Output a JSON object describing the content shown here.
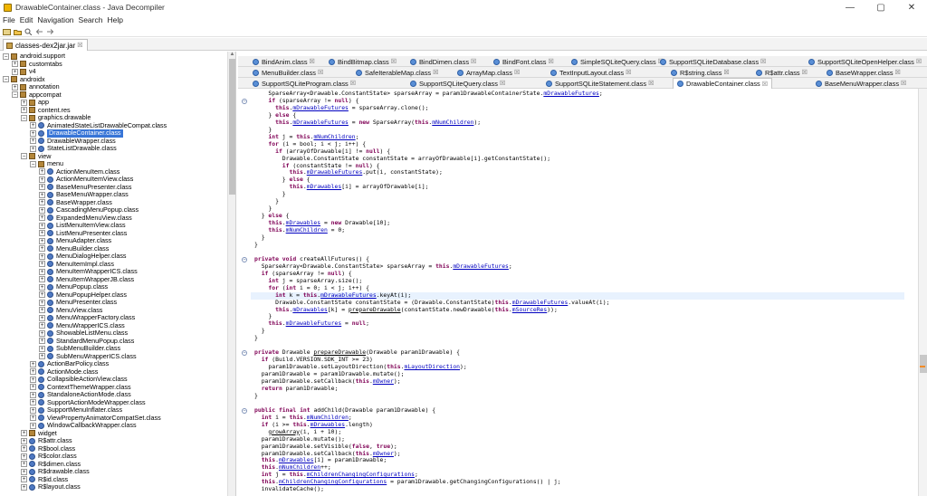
{
  "window": {
    "title": "DrawableContainer.class - Java Decompiler",
    "minimize": "—",
    "maximize": "▢",
    "close": "✕"
  },
  "menu": [
    "File",
    "Edit",
    "Navigation",
    "Search",
    "Help"
  ],
  "toolbar_icons": [
    "open-file-icon",
    "open-folder-icon",
    "search-icon",
    "back-icon",
    "forward-icon"
  ],
  "file_tab": {
    "label": "classes-dex2jar.jar",
    "close": "☒"
  },
  "tree": [
    {
      "d": 0,
      "exp": "−",
      "ico": "pkg",
      "label": "android.support"
    },
    {
      "d": 1,
      "exp": "+",
      "ico": "pkg",
      "label": "customtabs"
    },
    {
      "d": 1,
      "exp": "+",
      "ico": "pkg",
      "label": "v4"
    },
    {
      "d": 0,
      "exp": "−",
      "ico": "pkg",
      "label": "androidx"
    },
    {
      "d": 1,
      "exp": "+",
      "ico": "pkg",
      "label": "annotation"
    },
    {
      "d": 1,
      "exp": "−",
      "ico": "pkg",
      "label": "appcompat"
    },
    {
      "d": 2,
      "exp": "+",
      "ico": "pkg",
      "label": "app"
    },
    {
      "d": 2,
      "exp": "+",
      "ico": "pkg",
      "label": "content.res"
    },
    {
      "d": 2,
      "exp": "−",
      "ico": "pkg",
      "label": "graphics.drawable"
    },
    {
      "d": 3,
      "exp": "+",
      "ico": "cls",
      "label": "AnimatedStateListDrawableCompat.class"
    },
    {
      "d": 3,
      "exp": "+",
      "ico": "cls",
      "label": "DrawableContainer.class",
      "sel": true
    },
    {
      "d": 3,
      "exp": "+",
      "ico": "cls",
      "label": "DrawableWrapper.class"
    },
    {
      "d": 3,
      "exp": "+",
      "ico": "cls",
      "label": "StateListDrawable.class"
    },
    {
      "d": 2,
      "exp": "−",
      "ico": "pkg",
      "label": "view"
    },
    {
      "d": 3,
      "exp": "−",
      "ico": "pkg",
      "label": "menu"
    },
    {
      "d": 4,
      "exp": "+",
      "ico": "cls",
      "label": "ActionMenuItem.class"
    },
    {
      "d": 4,
      "exp": "+",
      "ico": "cls",
      "label": "ActionMenuItemView.class"
    },
    {
      "d": 4,
      "exp": "+",
      "ico": "cls",
      "label": "BaseMenuPresenter.class"
    },
    {
      "d": 4,
      "exp": "+",
      "ico": "cls",
      "label": "BaseMenuWrapper.class"
    },
    {
      "d": 4,
      "exp": "+",
      "ico": "cls",
      "label": "BaseWrapper.class"
    },
    {
      "d": 4,
      "exp": "+",
      "ico": "cls",
      "label": "CascadingMenuPopup.class"
    },
    {
      "d": 4,
      "exp": "+",
      "ico": "cls",
      "label": "ExpandedMenuView.class"
    },
    {
      "d": 4,
      "exp": "+",
      "ico": "cls",
      "label": "ListMenuItemView.class"
    },
    {
      "d": 4,
      "exp": "+",
      "ico": "cls",
      "label": "ListMenuPresenter.class"
    },
    {
      "d": 4,
      "exp": "+",
      "ico": "cls",
      "label": "MenuAdapter.class"
    },
    {
      "d": 4,
      "exp": "+",
      "ico": "cls",
      "label": "MenuBuilder.class"
    },
    {
      "d": 4,
      "exp": "+",
      "ico": "cls",
      "label": "MenuDialogHelper.class"
    },
    {
      "d": 4,
      "exp": "+",
      "ico": "cls",
      "label": "MenuItemImpl.class"
    },
    {
      "d": 4,
      "exp": "+",
      "ico": "cls",
      "label": "MenuItemWrapperICS.class"
    },
    {
      "d": 4,
      "exp": "+",
      "ico": "cls",
      "label": "MenuItemWrapperJB.class"
    },
    {
      "d": 4,
      "exp": "+",
      "ico": "cls",
      "label": "MenuPopup.class"
    },
    {
      "d": 4,
      "exp": "+",
      "ico": "cls",
      "label": "MenuPopupHelper.class"
    },
    {
      "d": 4,
      "exp": "+",
      "ico": "cls",
      "label": "MenuPresenter.class"
    },
    {
      "d": 4,
      "exp": "+",
      "ico": "cls",
      "label": "MenuView.class"
    },
    {
      "d": 4,
      "exp": "+",
      "ico": "cls",
      "label": "MenuWrapperFactory.class"
    },
    {
      "d": 4,
      "exp": "+",
      "ico": "cls",
      "label": "MenuWrapperICS.class"
    },
    {
      "d": 4,
      "exp": "+",
      "ico": "cls",
      "label": "ShowableListMenu.class"
    },
    {
      "d": 4,
      "exp": "+",
      "ico": "cls",
      "label": "StandardMenuPopup.class"
    },
    {
      "d": 4,
      "exp": "+",
      "ico": "cls",
      "label": "SubMenuBuilder.class"
    },
    {
      "d": 4,
      "exp": "+",
      "ico": "cls",
      "label": "SubMenuWrapperICS.class"
    },
    {
      "d": 3,
      "exp": "+",
      "ico": "cls",
      "label": "ActionBarPolicy.class"
    },
    {
      "d": 3,
      "exp": "+",
      "ico": "cls",
      "label": "ActionMode.class"
    },
    {
      "d": 3,
      "exp": "+",
      "ico": "cls",
      "label": "CollapsibleActionView.class"
    },
    {
      "d": 3,
      "exp": "+",
      "ico": "cls",
      "label": "ContextThemeWrapper.class"
    },
    {
      "d": 3,
      "exp": "+",
      "ico": "cls",
      "label": "StandaloneActionMode.class"
    },
    {
      "d": 3,
      "exp": "+",
      "ico": "cls",
      "label": "SupportActionModeWrapper.class"
    },
    {
      "d": 3,
      "exp": "+",
      "ico": "cls",
      "label": "SupportMenuInflater.class"
    },
    {
      "d": 3,
      "exp": "+",
      "ico": "cls",
      "label": "ViewPropertyAnimatorCompatSet.class"
    },
    {
      "d": 3,
      "exp": "+",
      "ico": "cls",
      "label": "WindowCallbackWrapper.class"
    },
    {
      "d": 2,
      "exp": "+",
      "ico": "pkg",
      "label": "widget"
    },
    {
      "d": 2,
      "exp": "+",
      "ico": "cls",
      "label": "R$attr.class"
    },
    {
      "d": 2,
      "exp": "+",
      "ico": "cls",
      "label": "R$bool.class"
    },
    {
      "d": 2,
      "exp": "+",
      "ico": "cls",
      "label": "R$color.class"
    },
    {
      "d": 2,
      "exp": "+",
      "ico": "cls",
      "label": "R$dimen.class"
    },
    {
      "d": 2,
      "exp": "+",
      "ico": "cls",
      "label": "R$drawable.class"
    },
    {
      "d": 2,
      "exp": "+",
      "ico": "cls",
      "label": "R$id.class"
    },
    {
      "d": 2,
      "exp": "+",
      "ico": "cls",
      "label": "R$layout.class"
    }
  ],
  "editor_tabs": [
    [
      {
        "label": "BindAnim.class"
      },
      {
        "label": "BindBitmap.class"
      },
      {
        "label": "BindDimen.class"
      },
      {
        "label": "BindFont.class"
      },
      {
        "label": "SimpleSQLiteQuery.class"
      },
      {
        "label": "SupportSQLiteDatabase.class"
      },
      {
        "label": "SupportSQLiteOpenHelper.class"
      }
    ],
    [
      {
        "label": "MenuBuilder.class"
      },
      {
        "label": "SafeIterableMap.class"
      },
      {
        "label": "ArrayMap.class"
      },
      {
        "label": "TextInputLayout.class"
      },
      {
        "label": "R$string.class"
      },
      {
        "label": "R$attr.class"
      },
      {
        "label": "BaseWrapper.class"
      }
    ],
    [
      {
        "label": "SupportSQLiteProgram.class"
      },
      {
        "label": "SupportSQLiteQuery.class"
      },
      {
        "label": "SupportSQLiteStatement.class"
      },
      {
        "label": "DrawableContainer.class",
        "active": true
      },
      {
        "label": "BaseMenuWrapper.class"
      }
    ]
  ],
  "tab_close": "☒",
  "code_lines": [
    "    SparseArray<Drawable.ConstantState> sparseArray = param1DrawableContainerState.mDrawableFutures;",
    "    if (sparseArray != null) {",
    "      this.mDrawableFutures = sparseArray.clone();",
    "    } else {",
    "      this.mDrawableFutures = new SparseArray(this.mNumChildren);",
    "    }",
    "    int j = this.mNumChildren;",
    "    for (i = bool; i < j; i++) {",
    "      if (arrayOfDrawable[i] != null) {",
    "        Drawable.ConstantState constantState = arrayOfDrawable[i].getConstantState();",
    "        if (constantState != null) {",
    "          this.mDrawableFutures.put(i, constantState);",
    "        } else {",
    "          this.mDrawables[i] = arrayOfDrawable[i];",
    "        }",
    "      }",
    "    }",
    "  } else {",
    "    this.mDrawables = new Drawable[10];",
    "    this.mNumChildren = 0;",
    "  }",
    "}",
    "",
    "private void createAllFutures() {",
    "  SparseArray<Drawable.ConstantState> sparseArray = this.mDrawableFutures;",
    "  if (sparseArray != null) {",
    "    int j = sparseArray.size();",
    "    for (int i = 0; i < j; i++) {",
    "      int k = this.mDrawableFutures.keyAt(i);",
    "      Drawable.ConstantState constantState = (Drawable.ConstantState)this.mDrawableFutures.valueAt(i);",
    "      this.mDrawables[k] = prepareDrawable(constantState.newDrawable(this.mSourceRes));",
    "    }",
    "    this.mDrawableFutures = null;",
    "  }",
    "}",
    "",
    "private Drawable prepareDrawable(Drawable param1Drawable) {",
    "  if (Build.VERSION.SDK_INT >= 23)",
    "    param1Drawable.setLayoutDirection(this.mLayoutDirection);",
    "  param1Drawable = param1Drawable.mutate();",
    "  param1Drawable.setCallback(this.mOwner);",
    "  return param1Drawable;",
    "}",
    "",
    "public final int addChild(Drawable param1Drawable) {",
    "  int i = this.mNumChildren;",
    "  if (i >= this.mDrawables.length)",
    "    growArray(i, i + 10);",
    "  param1Drawable.mutate();",
    "  param1Drawable.setVisible(false, true);",
    "  param1Drawable.setCallback(this.mOwner);",
    "  this.mDrawables[i] = param1Drawable;",
    "  this.mNumChildren++;",
    "  int j = this.mChildrenChangingConfigurations;",
    "  this.mChildrenChangingConfigurations = param1Drawable.getChangingConfigurations() | j;",
    "  invalidateCache();"
  ],
  "highlight_line": 28,
  "fold_lines": [
    1,
    23,
    36,
    44
  ],
  "colors": {
    "selection": "#3875d7",
    "keyword": "#7f0055",
    "field": "#0000c0",
    "line_highlight": "#e8f2fe",
    "marker": "#f28c28"
  }
}
